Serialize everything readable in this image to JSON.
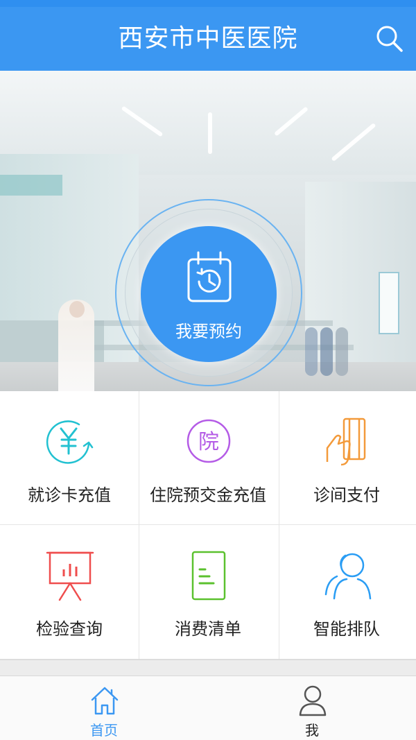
{
  "app": {
    "title": "西安市中医医院"
  },
  "hero": {
    "booking_label": "我要预约"
  },
  "services": [
    {
      "label": "就诊卡充值",
      "icon": "yuan-refresh-icon",
      "color": "#22c1d1"
    },
    {
      "label": "住院预交金充值",
      "icon": "hospital-badge-icon",
      "badge_text": "院",
      "color": "#b45be6"
    },
    {
      "label": "诊间支付",
      "icon": "hand-card-icon",
      "color": "#f39a3a"
    },
    {
      "label": "检验查询",
      "icon": "report-board-icon",
      "color": "#ef4d4d"
    },
    {
      "label": "消费清单",
      "icon": "bill-list-icon",
      "color": "#5bc12e"
    },
    {
      "label": "智能排队",
      "icon": "queue-people-icon",
      "color": "#2a9df4"
    }
  ],
  "tabs": [
    {
      "label": "首页",
      "icon": "home-icon",
      "active": true,
      "color": "#3b97f2"
    },
    {
      "label": "我",
      "icon": "user-icon",
      "active": false,
      "color": "#444444"
    }
  ],
  "colors": {
    "primary": "#3b97f2",
    "text": "#222222"
  }
}
